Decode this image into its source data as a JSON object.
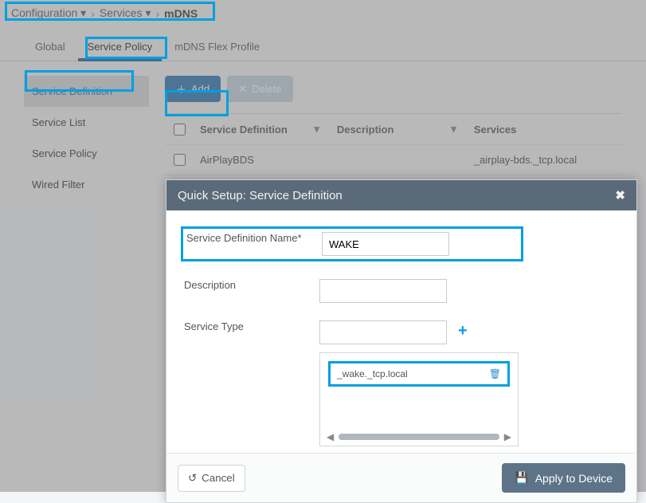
{
  "breadcrumb": {
    "configuration": "Configuration",
    "services": "Services",
    "current": "mDNS"
  },
  "tabs": {
    "global": "Global",
    "service_policy": "Service Policy",
    "flex": "mDNS Flex Profile"
  },
  "sidebar": {
    "items": [
      {
        "label": "Service Definition"
      },
      {
        "label": "Service List"
      },
      {
        "label": "Service Policy"
      },
      {
        "label": "Wired Filter"
      }
    ]
  },
  "toolbar": {
    "add": "Add",
    "delete": "Delete"
  },
  "table": {
    "headers": {
      "sd": "Service Definition",
      "desc": "Description",
      "svc": "Services"
    },
    "rows": [
      {
        "sd": "AirPlayBDS",
        "desc": "",
        "svc": "_airplay-bds._tcp.local"
      }
    ]
  },
  "modal": {
    "title": "Quick Setup: Service Definition",
    "name_label": "Service Definition Name*",
    "name_value": "WAKE",
    "desc_label": "Description",
    "desc_value": "",
    "type_label": "Service Type",
    "type_value": "",
    "type_items": [
      "_wake._tcp.local"
    ],
    "cancel": "Cancel",
    "apply": "Apply to Device"
  }
}
